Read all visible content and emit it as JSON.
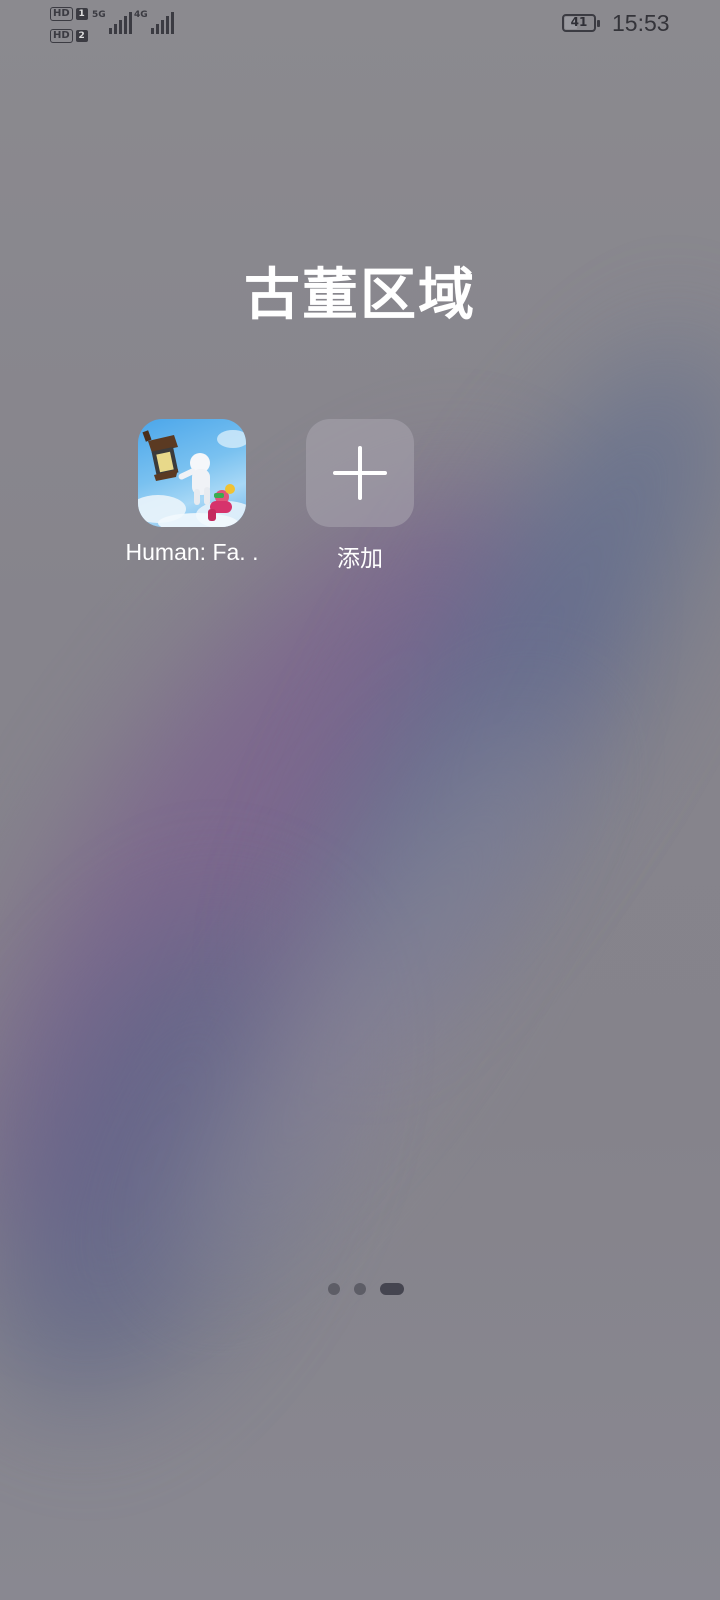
{
  "status_bar": {
    "sim1": {
      "badge": "HD",
      "slot": "1",
      "tech": "5G"
    },
    "sim2": {
      "badge": "HD",
      "slot": "2",
      "tech": "4G"
    },
    "battery_level": "41",
    "battery_fraction": 0.41,
    "time": "15:53"
  },
  "folder": {
    "title": "古董区域",
    "apps": [
      {
        "label": "Human: Fa. .",
        "icon": "human-fall-flat-app-icon"
      },
      {
        "label": "添加",
        "icon": "plus-icon"
      }
    ]
  },
  "page_indicator": {
    "pages": 3,
    "active_index": 2
  }
}
